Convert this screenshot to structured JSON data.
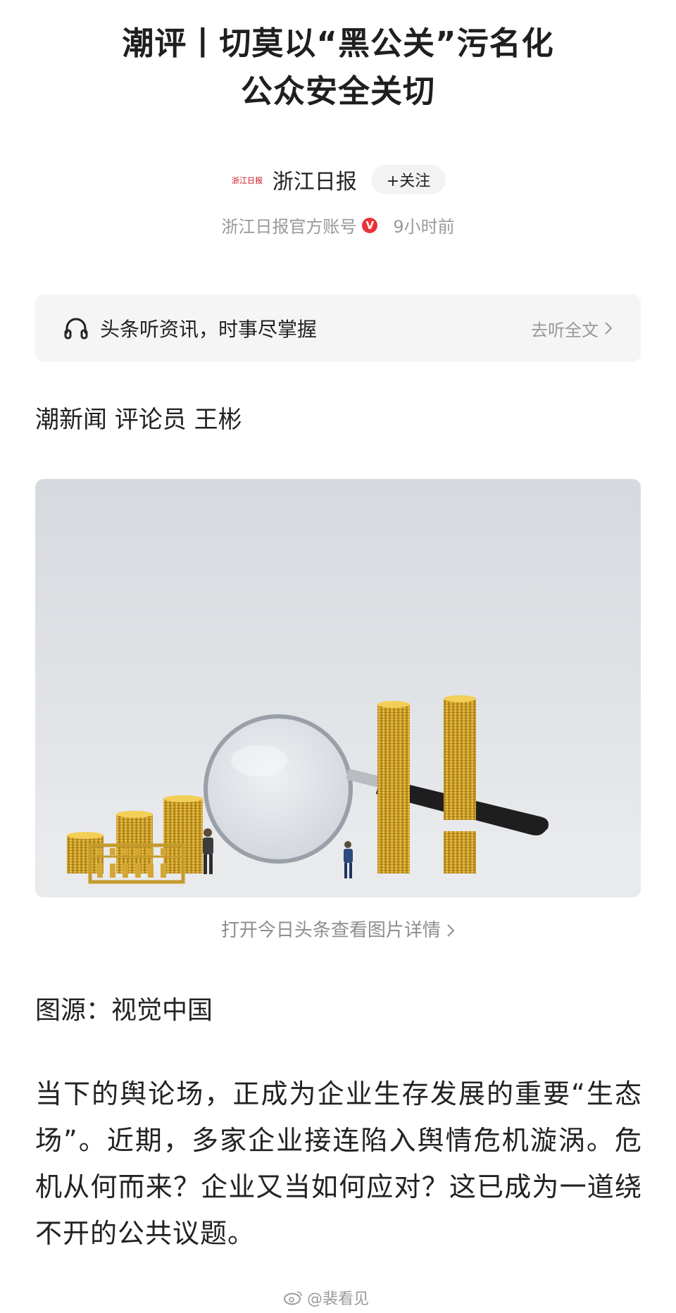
{
  "article": {
    "title_line1": "潮评丨切莫以“黑公关”污名化",
    "title_line2": "公众安全关切",
    "author": {
      "logo_text": "浙江日报",
      "name": "浙江日报",
      "follow_label": "+关注",
      "account_label": "浙江日报官方账号",
      "verified_badge": "V",
      "time": "9小时前"
    },
    "listen": {
      "icon": "headphones-icon",
      "label": "头条听资讯，时事尽掌握",
      "link_label": "去听全文",
      "link_icon": "chevron-right-icon"
    },
    "byline": "潮新闻 评论员 王彬",
    "figure": {
      "caption": "打开今日头条查看图片详情",
      "caption_icon": "chevron-right-icon"
    },
    "source": "图源：视觉中国",
    "body": "当下的舆论场，正成为企业生存发展的重要“生态场”。近期，多家企业接连陷入舆情危机漩涡。危机从何而来？企业又当如何应对？这已成为一道绕不开的公共议题。"
  },
  "watermark": {
    "icon": "weibo-icon",
    "text": "@裴看见"
  },
  "colors": {
    "verified": "#e8333a",
    "muted": "#999999",
    "panel": "#f5f5f6"
  }
}
